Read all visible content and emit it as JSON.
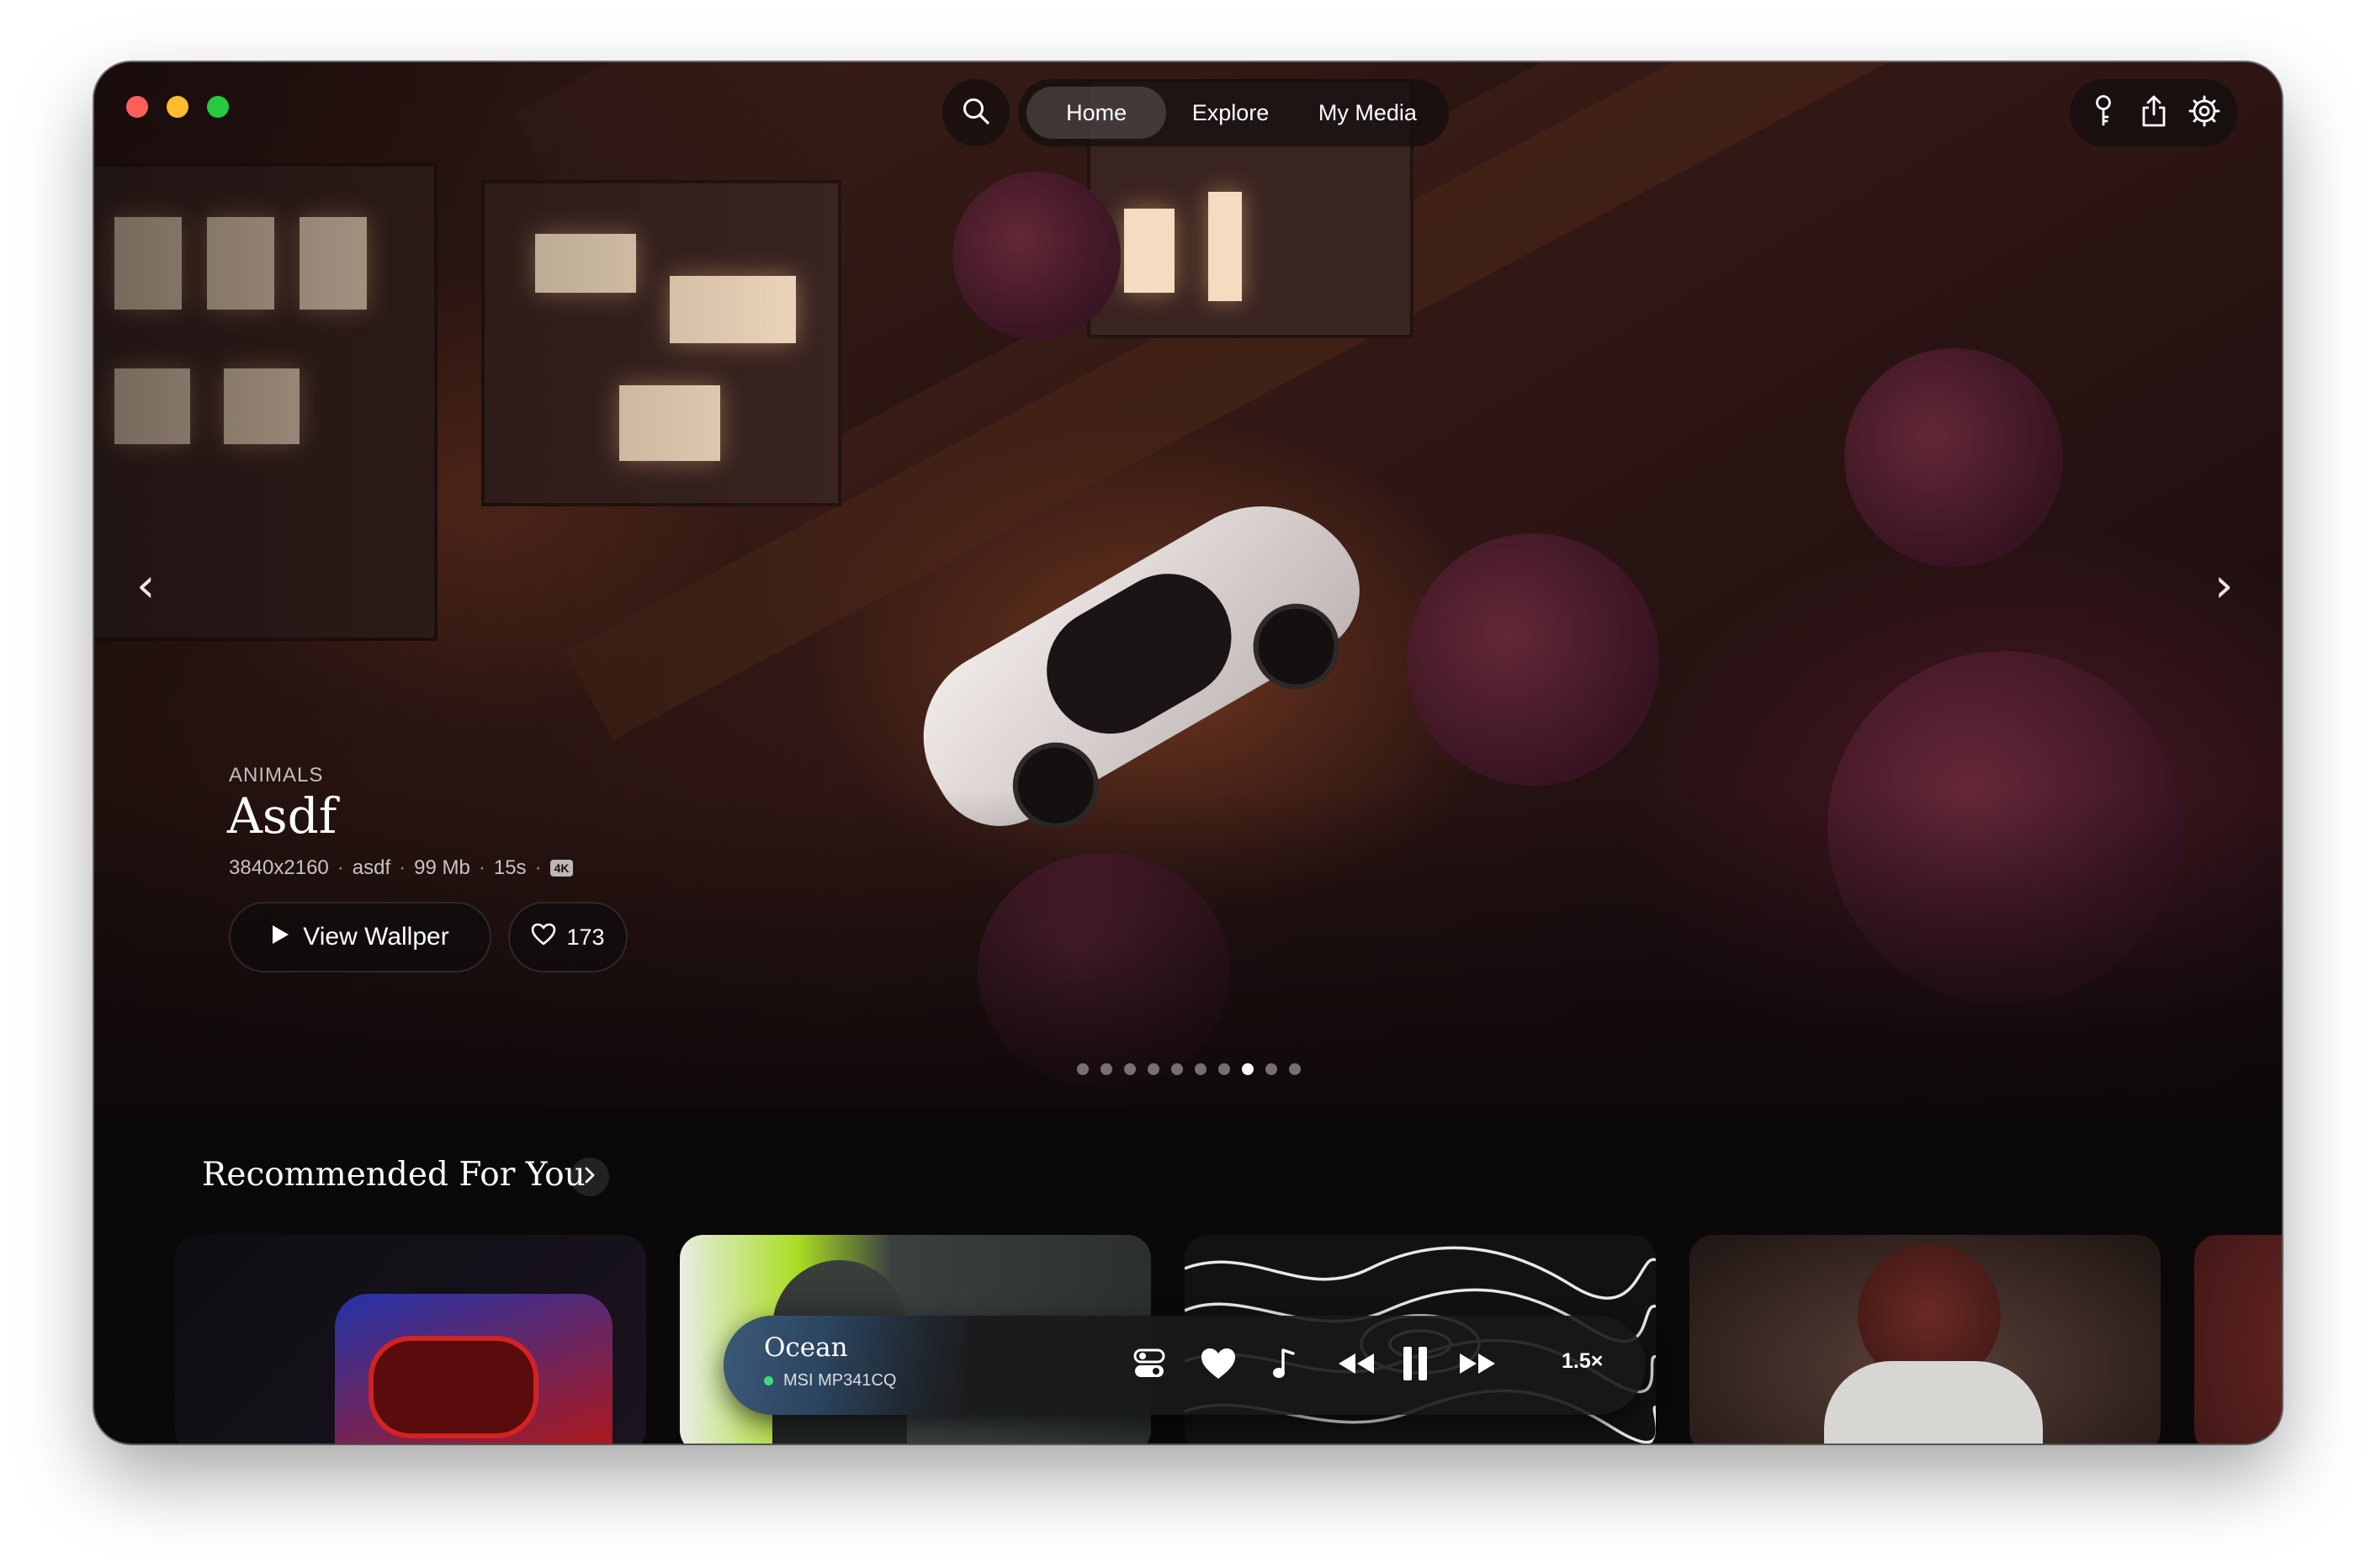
{
  "window": {
    "traffic_lights": [
      "#ff5f57",
      "#febc2e",
      "#28c840"
    ]
  },
  "nav": {
    "tabs": [
      {
        "label": "Home",
        "active": true
      },
      {
        "label": "Explore",
        "active": false
      },
      {
        "label": "My Media",
        "active": false
      }
    ],
    "icons": [
      "search-icon",
      "key-icon",
      "share-icon",
      "gear-icon"
    ]
  },
  "hero": {
    "category": "ANIMALS",
    "title": "Asdf",
    "meta": {
      "resolution": "3840x2160",
      "author": "asdf",
      "size": "99 Mb",
      "duration": "15s",
      "badge": "4K"
    },
    "view_label": "View Wallper",
    "likes": "173",
    "carousel": {
      "count": 10,
      "active_index": 7
    },
    "arrow_left": "‹",
    "arrow_right": "›"
  },
  "recommended": {
    "title": "Recommended For You",
    "cards": [
      "card-1",
      "card-2",
      "card-3",
      "card-4",
      "card-5"
    ]
  },
  "player": {
    "name": "Ocean",
    "device": "MSI MP341CQ",
    "status_color": "#3ddc84",
    "speed": "1.5×",
    "icons": [
      "toggle-icon",
      "heart-icon",
      "music-note-icon",
      "rewind-icon",
      "pause-icon",
      "fast-forward-icon"
    ]
  }
}
